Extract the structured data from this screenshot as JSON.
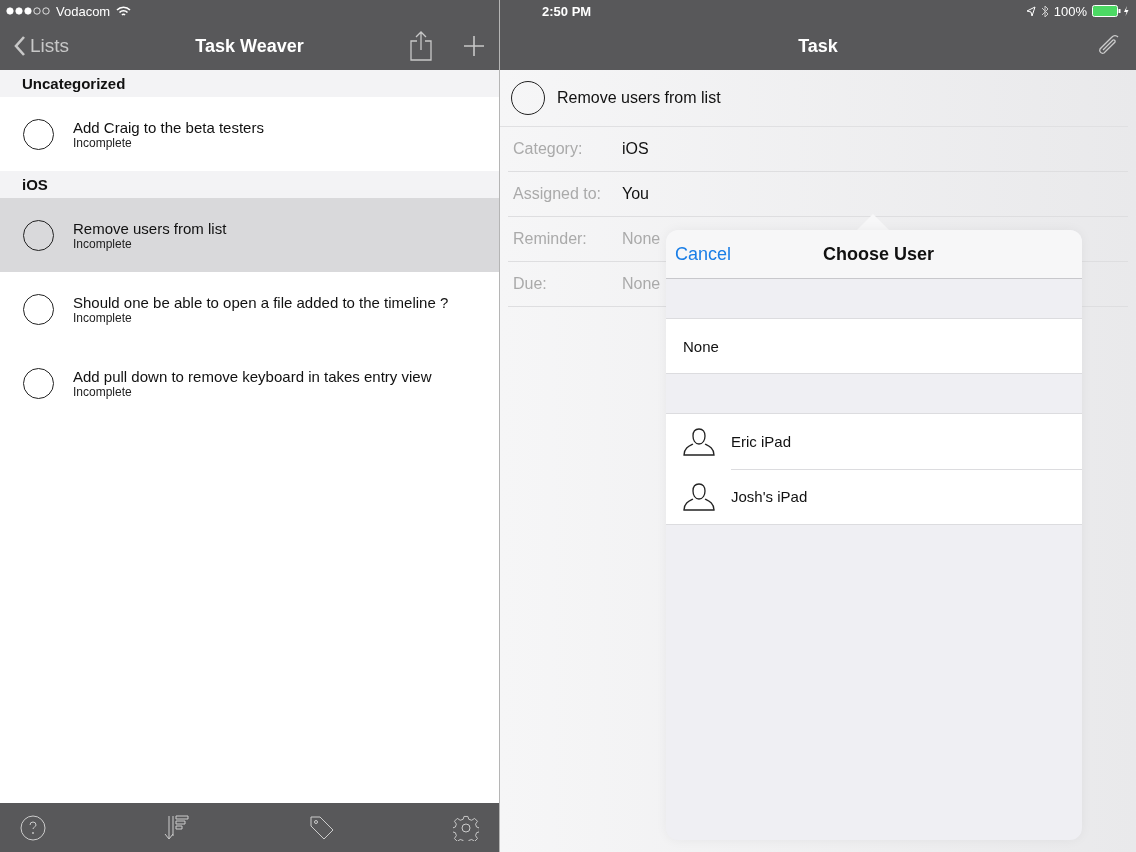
{
  "status_bar": {
    "carrier": "Vodacom",
    "time": "2:50 PM",
    "battery": "100%"
  },
  "list_pane": {
    "back": "Lists",
    "title": "Task Weaver",
    "sections": [
      {
        "title": "Uncategorized",
        "tasks": [
          {
            "title": "Add Craig to the beta testers",
            "status": "Incomplete",
            "completed": false,
            "selected": false
          }
        ]
      },
      {
        "title": "iOS",
        "tasks": [
          {
            "title": "Remove users from list",
            "status": "Incomplete",
            "completed": false,
            "selected": true
          },
          {
            "title": "Should one be able to open a file added to the timeline ?",
            "status": "Incomplete",
            "completed": false,
            "selected": false
          },
          {
            "title": "Add pull down to remove keyboard in takes entry view",
            "status": "Incomplete",
            "completed": false,
            "selected": false
          }
        ]
      }
    ]
  },
  "detail_pane": {
    "title": "Task",
    "task": {
      "title": "Remove users from list",
      "completed": false
    },
    "fields": [
      {
        "label": "Category:",
        "value": "iOS",
        "empty": false
      },
      {
        "label": "Assigned to:",
        "value": "You",
        "empty": false
      },
      {
        "label": "Reminder:",
        "value": "None",
        "empty": true
      },
      {
        "label": "Due:",
        "value": "None",
        "empty": true
      }
    ]
  },
  "popover": {
    "cancel": "Cancel",
    "title": "Choose User",
    "none_option": {
      "label": "None",
      "selected": false
    },
    "users": [
      {
        "name": "Eric iPad",
        "selected": false
      },
      {
        "name": "Josh's iPad",
        "selected": false
      }
    ]
  }
}
